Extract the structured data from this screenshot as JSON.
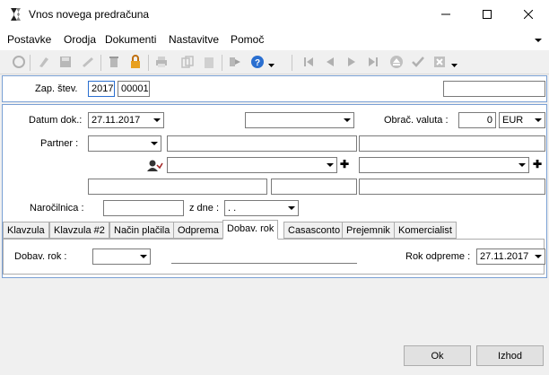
{
  "window": {
    "title": "Vnos novega predračuna",
    "minimize": "—",
    "maximize": "☐",
    "close": "✕"
  },
  "menu": {
    "items": [
      "Postavke",
      "Orodja",
      "Dokumenti",
      "Nastavitve",
      "Pomoč"
    ],
    "overflow": "⌄"
  },
  "toolbar": {
    "icons": [
      "refresh-icon",
      "edit-icon",
      "save-icon",
      "pencil-icon",
      "delete-icon",
      "lock-icon",
      "print-icon",
      "copy-icon",
      "paste-icon",
      "export-icon",
      "help-icon",
      "first-icon",
      "prev-icon",
      "next-icon",
      "last-icon",
      "eject-icon",
      "confirm-icon",
      "cancel-icon"
    ]
  },
  "header": {
    "zap_stev_label": "Zap. štev.",
    "year": "2017",
    "number": "00001",
    "right_field": ""
  },
  "form": {
    "datum_label": "Datum dok.:",
    "datum_value": "27.11.2017",
    "doc_type_value": "",
    "valuta_label": "Obrač. valuta :",
    "rate_value": "0",
    "currency": "EUR",
    "partner_label": "Partner :",
    "partner_combo": "",
    "narocilnica_label": "Naročilnica :",
    "narocilnica_value": "",
    "z_dne_label": "z dne :",
    "z_dne_value": ". ."
  },
  "tabs": {
    "labels": [
      "Klavzula",
      "Klavzula #2",
      "Način plačila",
      "Odprema",
      "Dobav. rok",
      "Casasconto",
      "Prejemnik",
      "Komercialist"
    ],
    "active_index": 4
  },
  "tab_content": {
    "dobav_rok_label": "Dobav. rok :",
    "dobav_rok_value": "",
    "rok_odpreme_label": "Rok odpreme :",
    "rok_odpreme_value": "27.11.2017"
  },
  "buttons": {
    "ok": "Ok",
    "izhod": "Izhod"
  }
}
